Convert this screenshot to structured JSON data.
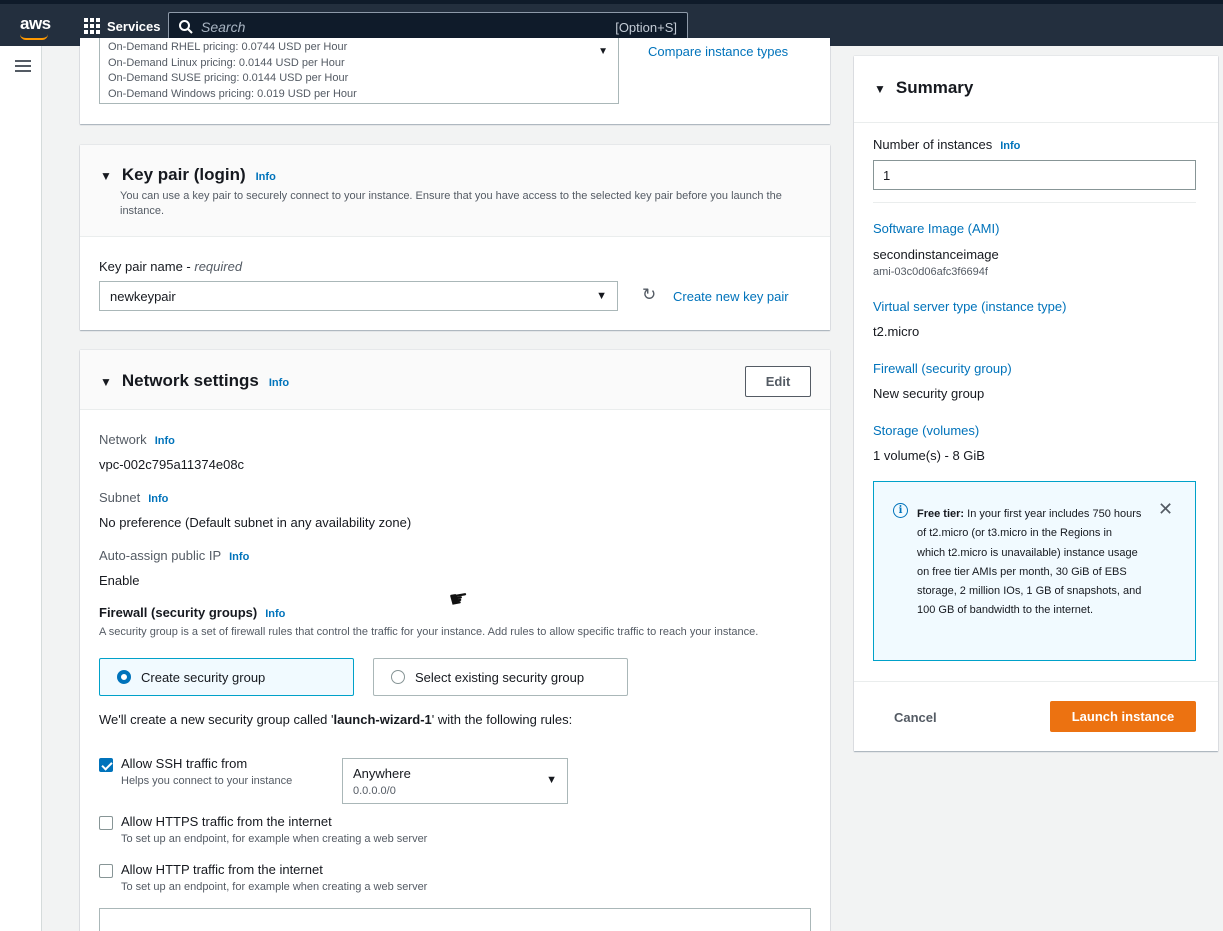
{
  "topbar": {
    "logo": "aws",
    "services_label": "Services",
    "search_placeholder": "Search",
    "search_shortcut": "[Option+S]"
  },
  "ami_section": {
    "pricing_lines": [
      "On-Demand RHEL pricing: 0.0744 USD per Hour",
      "On-Demand Linux pricing: 0.0144 USD per Hour",
      "On-Demand SUSE pricing: 0.0144 USD per Hour",
      "On-Demand Windows pricing: 0.019 USD per Hour"
    ],
    "compare_link": "Compare instance types"
  },
  "key_pair": {
    "title": "Key pair (login)",
    "info": "Info",
    "description": "You can use a key pair to securely connect to your instance. Ensure that you have access to the selected key pair before you launch the instance.",
    "label": "Key pair name - ",
    "required": "required",
    "selected": "newkeypair",
    "create_link": "Create new key pair"
  },
  "network": {
    "title": "Network settings",
    "info": "Info",
    "edit_button": "Edit",
    "network_label": "Network",
    "network_value": "vpc-002c795a11374e08c",
    "subnet_label": "Subnet",
    "subnet_value": "No preference (Default subnet in any availability zone)",
    "public_ip_label": "Auto-assign public IP",
    "public_ip_value": "Enable",
    "firewall_title": "Firewall (security groups)",
    "firewall_desc": "A security group is a set of firewall rules that control the traffic for your instance. Add rules to allow specific traffic to reach your instance.",
    "option_create": "Create security group",
    "option_existing": "Select existing security group",
    "wizard_prefix": "We'll create a new security group called '",
    "wizard_name": "launch-wizard-1",
    "wizard_suffix": "' with the following rules:",
    "rules": [
      {
        "title": "Allow SSH traffic from",
        "sub": "Helps you connect to your instance",
        "checked": true
      },
      {
        "title": "Allow HTTPS traffic from the internet",
        "sub": "To set up an endpoint, for example when creating a web server",
        "checked": false
      },
      {
        "title": "Allow HTTP traffic from the internet",
        "sub": "To set up an endpoint, for example when creating a web server",
        "checked": false
      }
    ],
    "ssh_source": "Anywhere",
    "ssh_source_sub": "0.0.0.0/0"
  },
  "summary": {
    "title": "Summary",
    "instances_label": "Number of instances",
    "info": "Info",
    "instances_value": "1",
    "ami_link": "Software Image (AMI)",
    "ami_name": "secondinstanceimage",
    "ami_id": "ami-03c0d06afc3f6694f",
    "type_link": "Virtual server type (instance type)",
    "type_value": "t2.micro",
    "firewall_link": "Firewall (security group)",
    "firewall_value": "New security group",
    "storage_link": "Storage (volumes)",
    "storage_value": "1 volume(s) - 8 GiB",
    "free_tier_bold": "Free tier:",
    "free_tier_text": " In your first year includes 750 hours of t2.micro (or t3.micro in the Regions in which t2.micro is unavailable) instance usage on free tier AMIs per month, 30 GiB of EBS storage, 2 million IOs, 1 GB of snapshots, and 100 GB of bandwidth to the internet.",
    "cancel": "Cancel",
    "launch": "Launch instance"
  },
  "colors": {
    "topbar": "#232f3e",
    "link": "#0073bb",
    "launch": "#ec7211"
  }
}
